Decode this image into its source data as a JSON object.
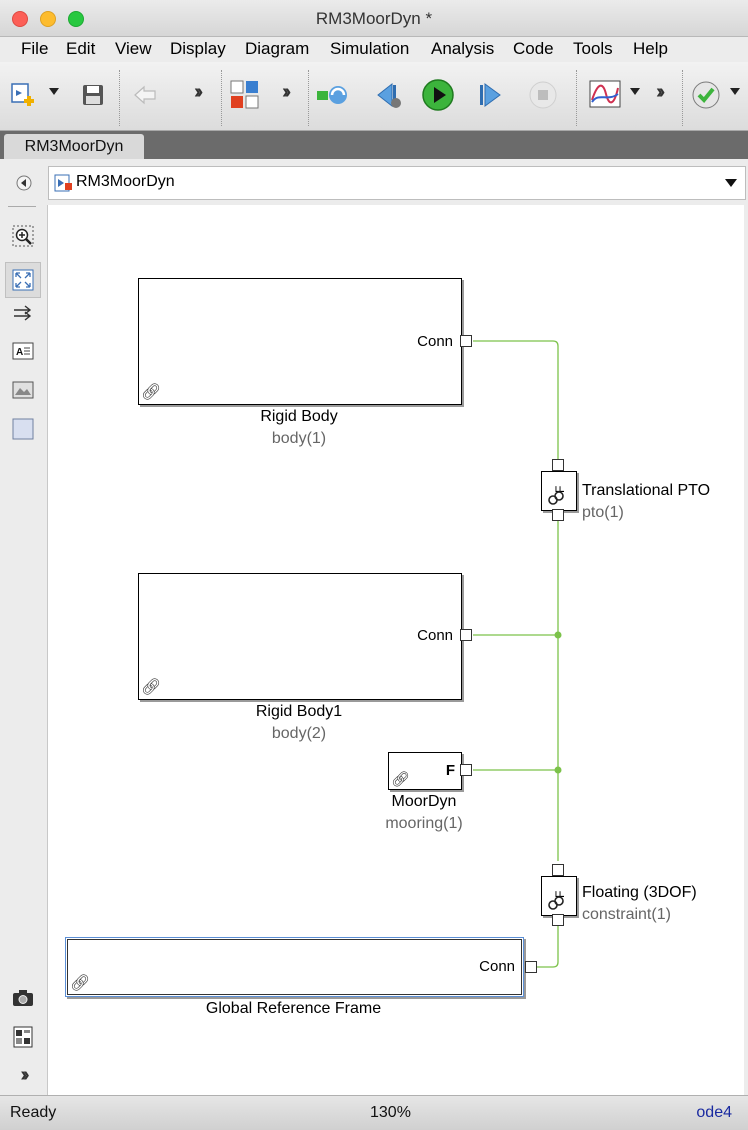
{
  "window": {
    "title": "RM3MoorDyn *"
  },
  "menu": [
    "File",
    "Edit",
    "View",
    "Display",
    "Diagram",
    "Simulation",
    "Analysis",
    "Code",
    "Tools",
    "Help"
  ],
  "tab": {
    "label": "RM3MoorDyn"
  },
  "address": {
    "path": "RM3MoorDyn"
  },
  "blocks": {
    "rigid_body": {
      "name": "Rigid Body",
      "sub": "body(1)",
      "port": "Conn"
    },
    "rigid_body1": {
      "name": "Rigid Body1",
      "sub": "body(2)",
      "port": "Conn"
    },
    "moordyn": {
      "name": "MoorDyn",
      "sub": "mooring(1)",
      "port": "F"
    },
    "global_ref": {
      "name": "Global Reference Frame",
      "port": "Conn"
    },
    "pto": {
      "name": "Translational PTO",
      "sub": "pto(1)"
    },
    "floating": {
      "name": "Floating (3DOF)",
      "sub": "constraint(1)"
    }
  },
  "status": {
    "left": "Ready",
    "zoom": "130%",
    "solver": "ode4"
  },
  "colors": {
    "connection_line": "#7cc24a",
    "solver_text": "#1a2aa0",
    "highlight_border": "#5b8fd6"
  }
}
